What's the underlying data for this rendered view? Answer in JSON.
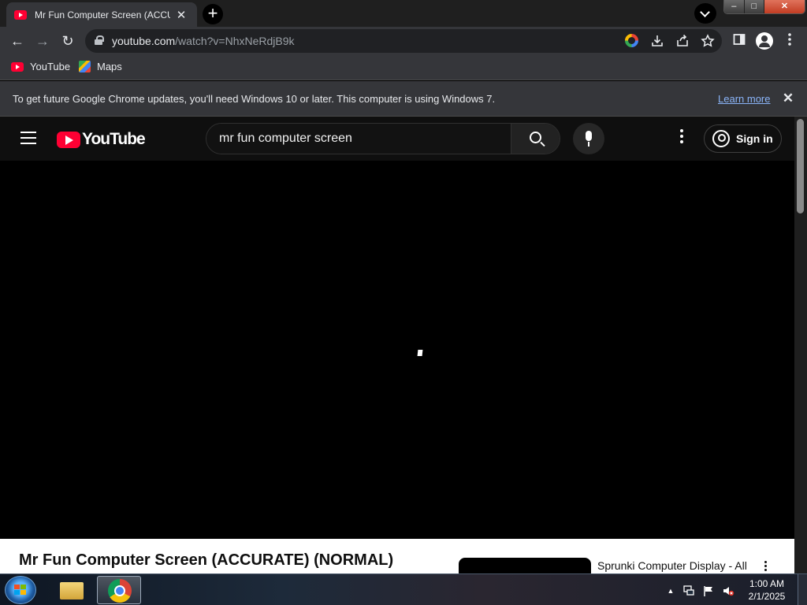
{
  "browser": {
    "tab": {
      "title": "Mr Fun Computer Screen (ACCURATE) (NORMAL)",
      "close": "✕"
    },
    "new_tab": "+",
    "window_buttons": {
      "minimize": "–",
      "maximize": "□",
      "close": "✕"
    },
    "toolbar": {
      "back": "←",
      "forward": "→",
      "reload": "↻"
    },
    "omnibox": {
      "domain": "youtube.com",
      "path": "/watch?v=NhxNeRdjB9k"
    },
    "bookmarks": [
      {
        "label": "YouTube"
      },
      {
        "label": "Maps"
      }
    ],
    "infobar": {
      "text": "To get future Google Chrome updates, you'll need Windows 10 or later. This computer is using Windows 7.",
      "link": "Learn more",
      "close": "✕"
    }
  },
  "youtube": {
    "logo_text": "YouTube",
    "search": {
      "query": "mr fun computer screen"
    },
    "signin_label": "Sign in",
    "video_title": "Mr Fun Computer Screen (ACCURATE) (NORMAL)",
    "related": [
      {
        "title": "Sprunki Computer Display - All"
      }
    ]
  },
  "taskbar": {
    "tray_arrow": "▲",
    "clock": {
      "time": "1:00 AM",
      "date": "2/1/2025"
    }
  },
  "colors": {
    "youtube_red": "#ff0033",
    "chrome_dark": "#35363a",
    "link_blue": "#8ab4f8"
  }
}
